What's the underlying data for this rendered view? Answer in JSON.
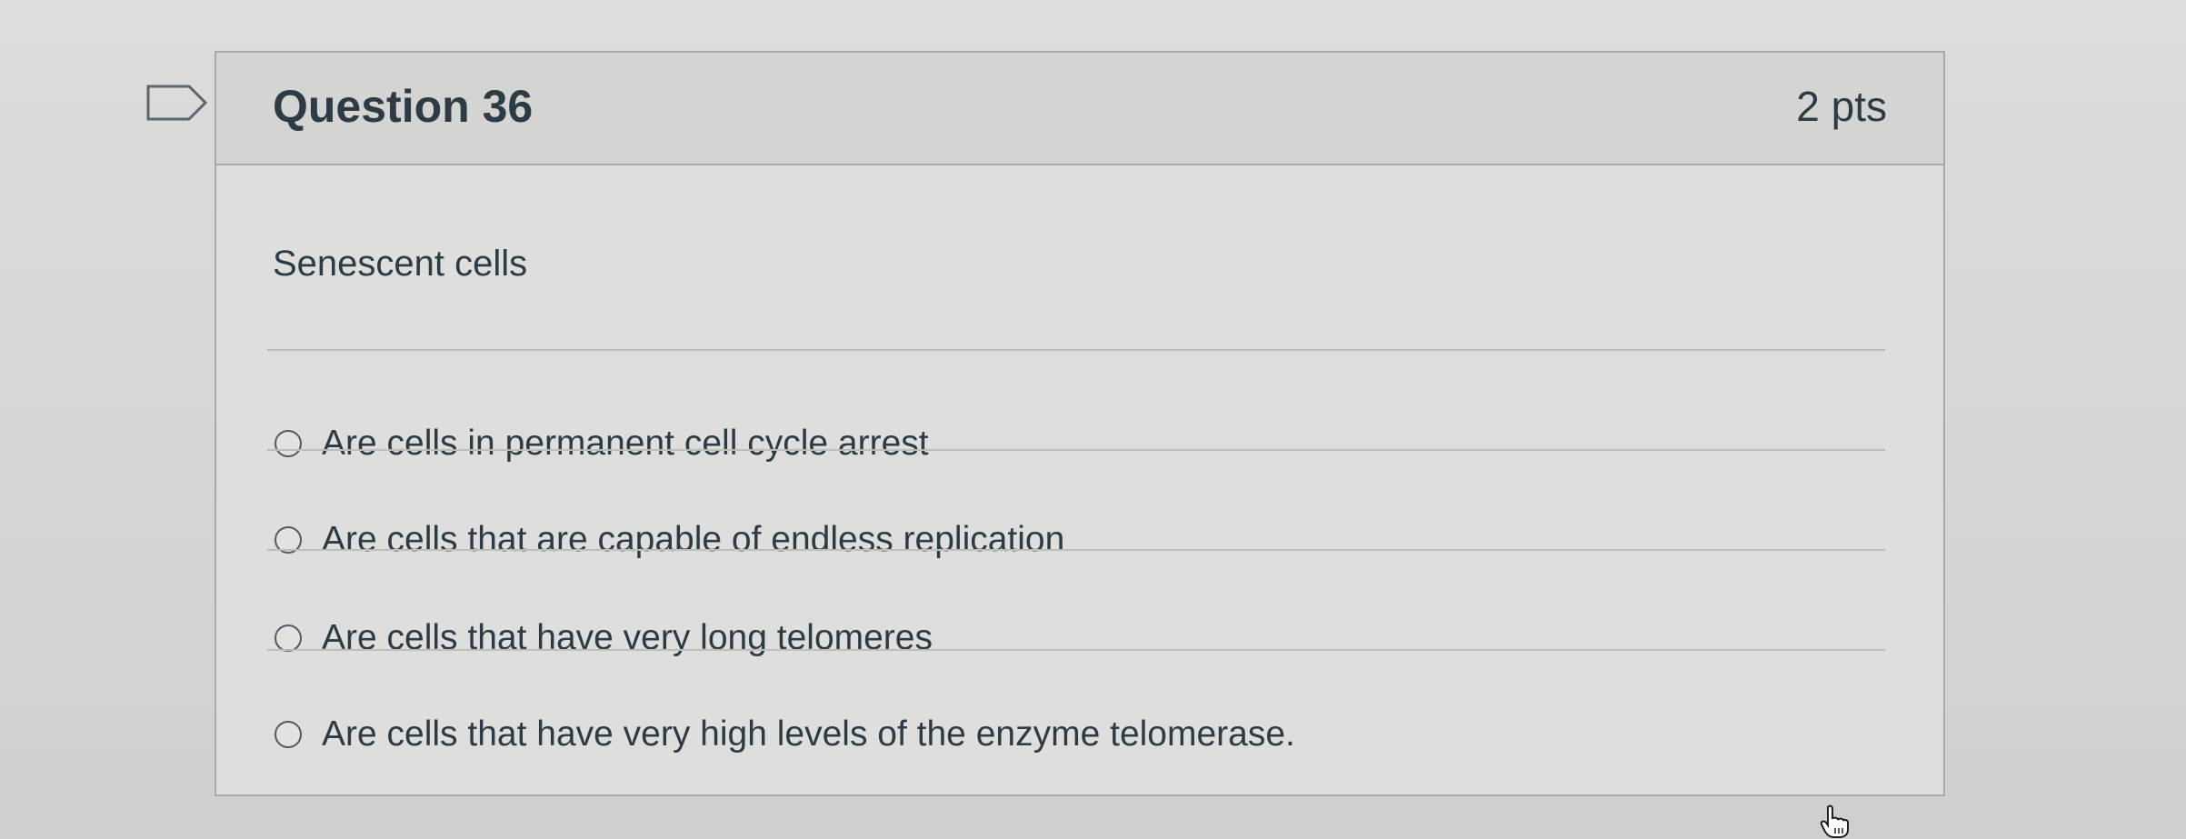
{
  "question": {
    "title": "Question 36",
    "points": "2 pts",
    "text": "Senescent cells"
  },
  "answers": [
    {
      "label": "Are cells in permanent cell cycle arrest",
      "selected": false
    },
    {
      "label": "Are cells that are capable of endless replication",
      "selected": false
    },
    {
      "label": "Are cells that have very long telomeres",
      "selected": false
    },
    {
      "label": "Are cells that have very high levels of the enzyme telomerase.",
      "selected": false
    }
  ],
  "icons": {
    "flag": "flag-outline-icon",
    "cursor": "hand-pointer-icon"
  },
  "colors": {
    "text": "#2d3b45",
    "border": "#a9aaa6",
    "header_bg": "#d4d5d2"
  }
}
